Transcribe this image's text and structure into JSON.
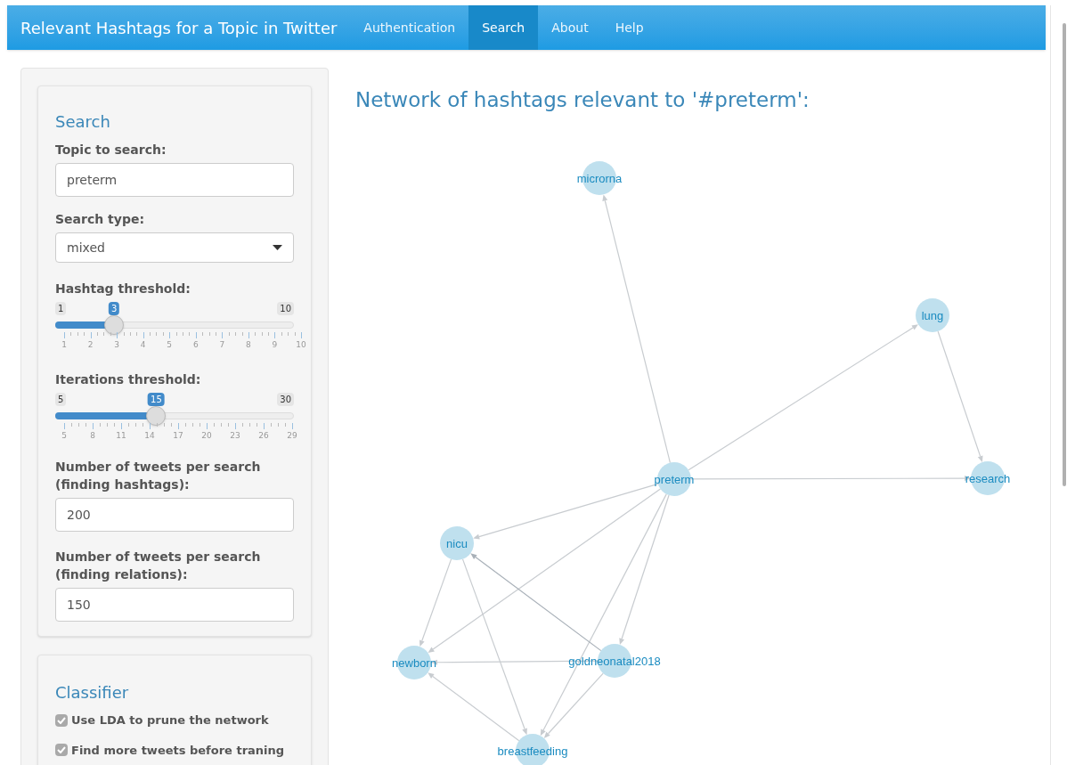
{
  "navbar": {
    "brand": "Relevant Hashtags for a Topic in Twitter",
    "tabs": [
      {
        "label": "Authentication",
        "selected": false
      },
      {
        "label": "Search",
        "selected": true
      },
      {
        "label": "About",
        "selected": false
      },
      {
        "label": "Help",
        "selected": false
      }
    ]
  },
  "search_panel": {
    "title": "Search",
    "topic": {
      "label": "Topic to search:",
      "value": "preterm"
    },
    "search_type": {
      "label": "Search type:",
      "value": "mixed"
    },
    "sliders": [
      {
        "label": "Hashtag threshold:",
        "min": "1",
        "max": "10",
        "value": "3",
        "level": 0.2222,
        "ticks": [
          "1",
          "2",
          "3",
          "4",
          "5",
          "6",
          "7",
          "8",
          "9",
          "10"
        ]
      },
      {
        "label": "Iterations threshold:",
        "min": "5",
        "max": "30",
        "value": "15",
        "level": 0.4,
        "ticks": [
          "5",
          "8",
          "11",
          "14",
          "17",
          "20",
          "23",
          "26",
          "29"
        ]
      }
    ],
    "fields": [
      {
        "label": "Number of tweets per search (finding hashtags):",
        "value": "200"
      },
      {
        "label": "Number of tweets per search (finding relations):",
        "value": "150"
      }
    ]
  },
  "classifier_panel": {
    "title": "Classifier",
    "options": [
      {
        "label": "Use LDA to prune the network",
        "checked": true
      },
      {
        "label": "Find more tweets before traning",
        "checked": true
      }
    ]
  },
  "network": {
    "title": "Network of hashtags relevant to '#preterm':",
    "nodes": [
      "microrna",
      "lung",
      "preterm",
      "research",
      "nicu",
      "newborn",
      "goldneonatal2018",
      "breastfeeding"
    ]
  }
}
